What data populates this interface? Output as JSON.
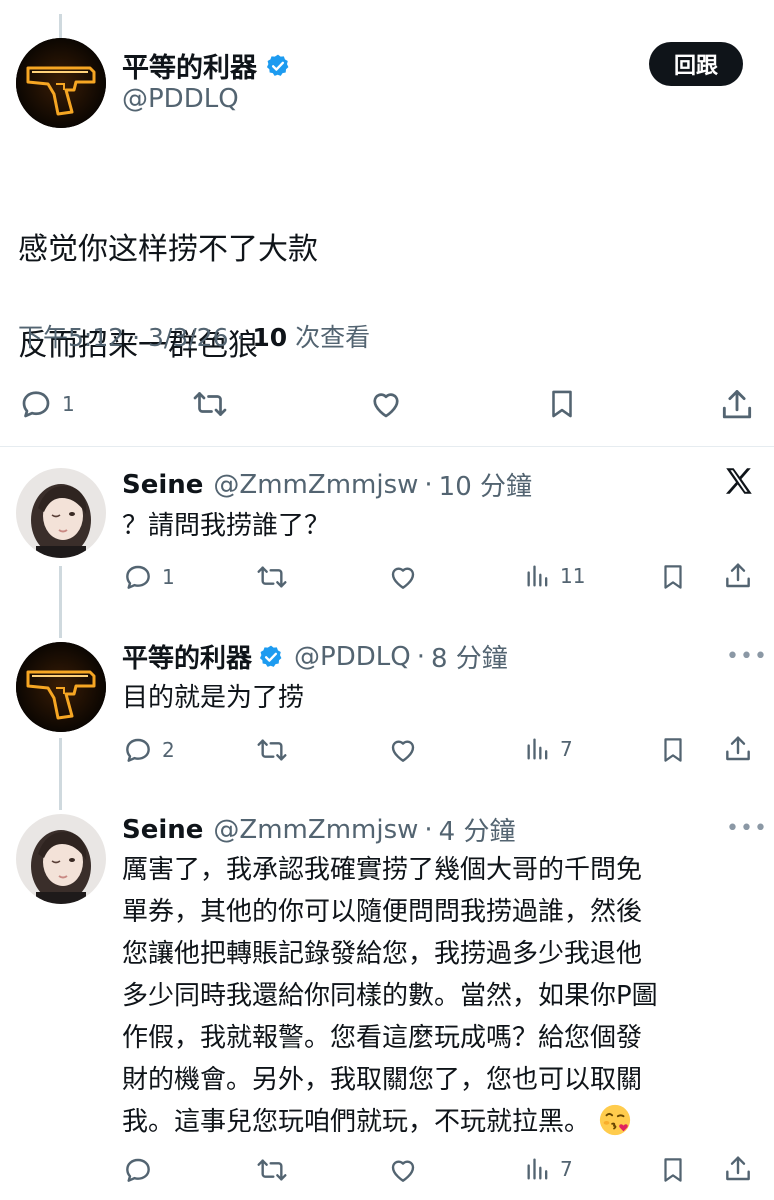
{
  "main_tweet": {
    "display_name": "平等的利器",
    "handle": "@PDDLQ",
    "follow_label": "回跟",
    "text_lines": [
      "感觉你这样捞不了大款",
      "反而招来一群色狼"
    ],
    "time": "下午5:12",
    "date": "3/3/26",
    "views_count": "10",
    "views_label": "次查看",
    "reply_count": "1"
  },
  "replies": [
    {
      "display_name": "Seine",
      "handle": "@ZmmZmmjsw",
      "time": "10 分鐘",
      "text": "？請問我捞誰了？",
      "reply_count": "1",
      "view_count": "11"
    },
    {
      "display_name": "平等的利器",
      "handle": "@PDDLQ",
      "time": "8 分鐘",
      "text": "目的就是为了捞",
      "reply_count": "2",
      "view_count": "7"
    },
    {
      "display_name": "Seine",
      "handle": "@ZmmZmmjsw",
      "time": "4 分鐘",
      "text_lines": [
        "厲害了，我承認我確實捞了幾個大哥的千問免",
        "單券，其他的你可以隨便問問我捞過誰，然後",
        "您讓他把轉賬記錄發給您，我捞過多少我退他",
        "多少同時我還給你同樣的數。當然，如果你P圖",
        "作假，我就報警。您看這麼玩成嗎？給您個發",
        "財的機會。另外，我取關您了，您也可以取關",
        "我。這事兒您玩咱們就玩，不玩就拉黑。"
      ],
      "emoji": "face-blowing-kiss",
      "reply_count": "",
      "view_count": "7"
    }
  ],
  "separators": {
    "dot": "·",
    "more": "•••"
  },
  "colors": {
    "text": "#0f1419",
    "secondary": "#536471",
    "verified": "#1d9bf0",
    "button_bg": "#0f1419",
    "divider": "#e6ecf0"
  }
}
